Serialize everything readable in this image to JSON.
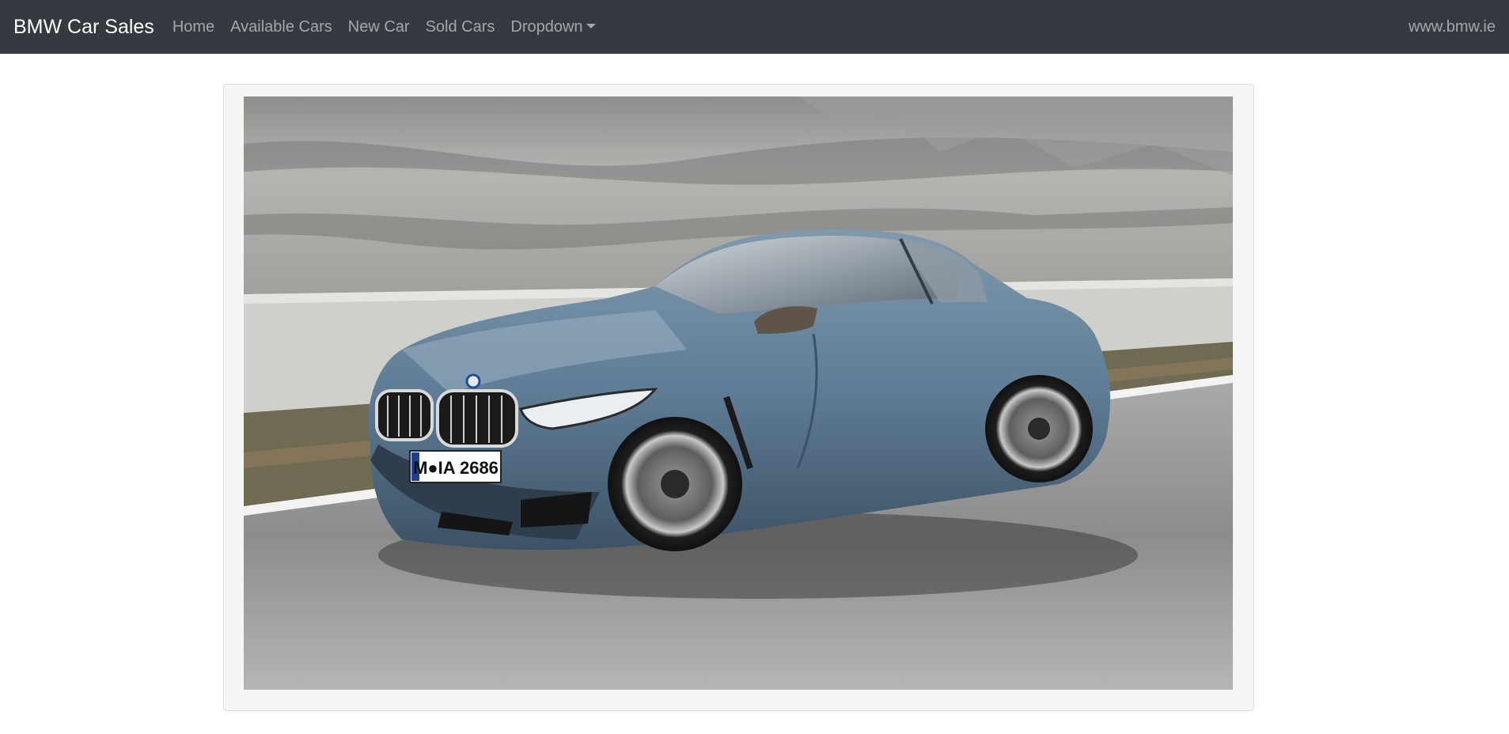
{
  "navbar": {
    "brand": "BMW Car Sales",
    "links": [
      "Home",
      "Available Cars",
      "New Car",
      "Sold Cars"
    ],
    "dropdown_label": "Dropdown",
    "right_link": "www.bmw.ie"
  },
  "hero": {
    "image_alt": "Blue BMW coupe driving on a road",
    "plate_text": "M●IA 2686"
  },
  "colors": {
    "navbar_bg": "#343a40",
    "car_body": "#5f7d96",
    "panel_bg": "#f5f5f5"
  }
}
